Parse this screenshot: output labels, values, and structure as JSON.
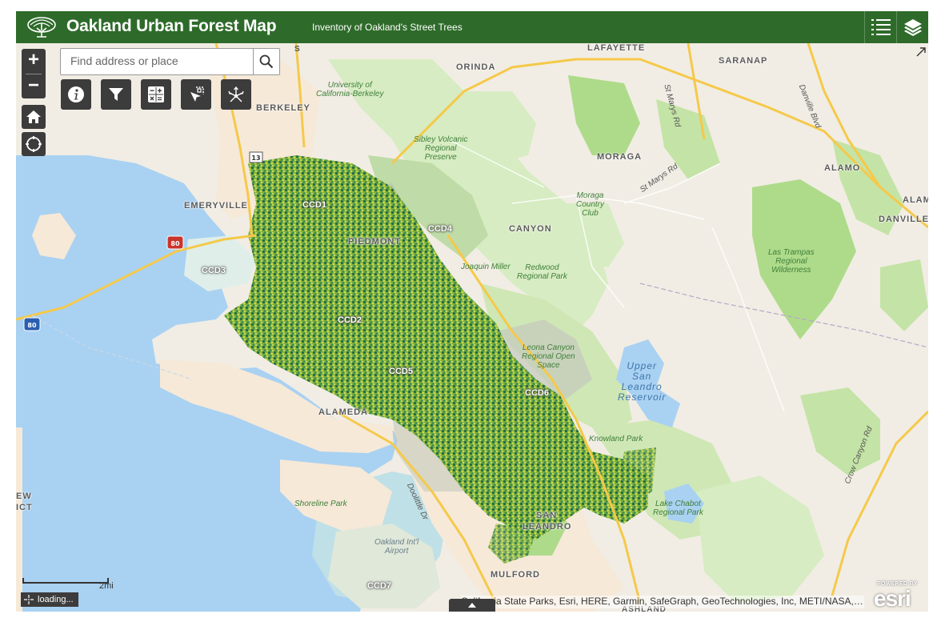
{
  "header": {
    "title": "Oakland Urban Forest Map",
    "subtitle": "Inventory of Oakland's Street Trees",
    "bg_color": "#2e6b2a"
  },
  "search": {
    "placeholder": "Find address or place"
  },
  "widgets": {
    "zoom_in": "+",
    "zoom_out": "−",
    "home_icon": "home-icon",
    "locate_icon": "locate-icon",
    "tools": [
      "info-icon",
      "filter-icon",
      "calculator-icon",
      "select-icon",
      "share-icon"
    ]
  },
  "scale": {
    "label": "2mi"
  },
  "status": {
    "loading": "loading..."
  },
  "attribution": "California State Parks, Esri, HERE, Garmin, SafeGraph, GeoTechnologies, Inc, METI/NASA, USGS",
  "esri": {
    "powered_by": "POWERED BY",
    "word": "esri"
  },
  "places": [
    "ORINDA",
    "LAFAYETTE",
    "SARANAP",
    "BERKELEY",
    "MORAGA",
    "ALAMO",
    "ALAM",
    "EMERYVILLE",
    "DANVILLE",
    "PIEDMONT",
    "CANYON",
    "ALAMEDA",
    "SAN",
    "LEANDRO",
    "MULFORD",
    "ASHLAND",
    "EW",
    "ICT"
  ],
  "parks": {
    "ucb": "University of\nCalifornia-Berkeley",
    "sibley": "Sibley Volcanic\nRegional\nPreserve",
    "moraga_cc": "Moraga\nCountry\nClub",
    "joaquin": "Joaquin Miller",
    "redwood": "Redwood\nRegional Park",
    "las_trampas": "Las Trampas\nRegional\nWilderness",
    "leona": "Leona Canyon\nRegional Open\nSpace",
    "knowland": "Knowland Park",
    "lake_chabot": "Lake Chabot\nRegional Park",
    "shoreline": "Shoreline Park",
    "airport": "Oakland Int'l\nAirport"
  },
  "water": {
    "upper_sl": "Upper\nSan\nLeandro\nReservoir"
  },
  "roads": {
    "st_marys": "St Marys Rd",
    "st_marys2": "St Marys Rd",
    "danville": "Danville Blvd",
    "crow": "Crow Canyon Rd",
    "doolittle": "Doolittle Dr",
    "i80a": "80",
    "i80b": "80",
    "r13": "13",
    "s": "S"
  },
  "districts": [
    "CCD1",
    "CCD2",
    "CCD3",
    "CCD4",
    "CCD5",
    "CCD6",
    "CCD7"
  ],
  "colors": {
    "water": "#a9d1f2",
    "land": "#f1ede4",
    "park": "#cfe7b5",
    "park_dark": "#aedb8a",
    "urban": "#f6e9d8",
    "tree_dark": "#1f6b47",
    "tree_mid": "#6fa83a",
    "tree_light": "#c8d94a"
  }
}
